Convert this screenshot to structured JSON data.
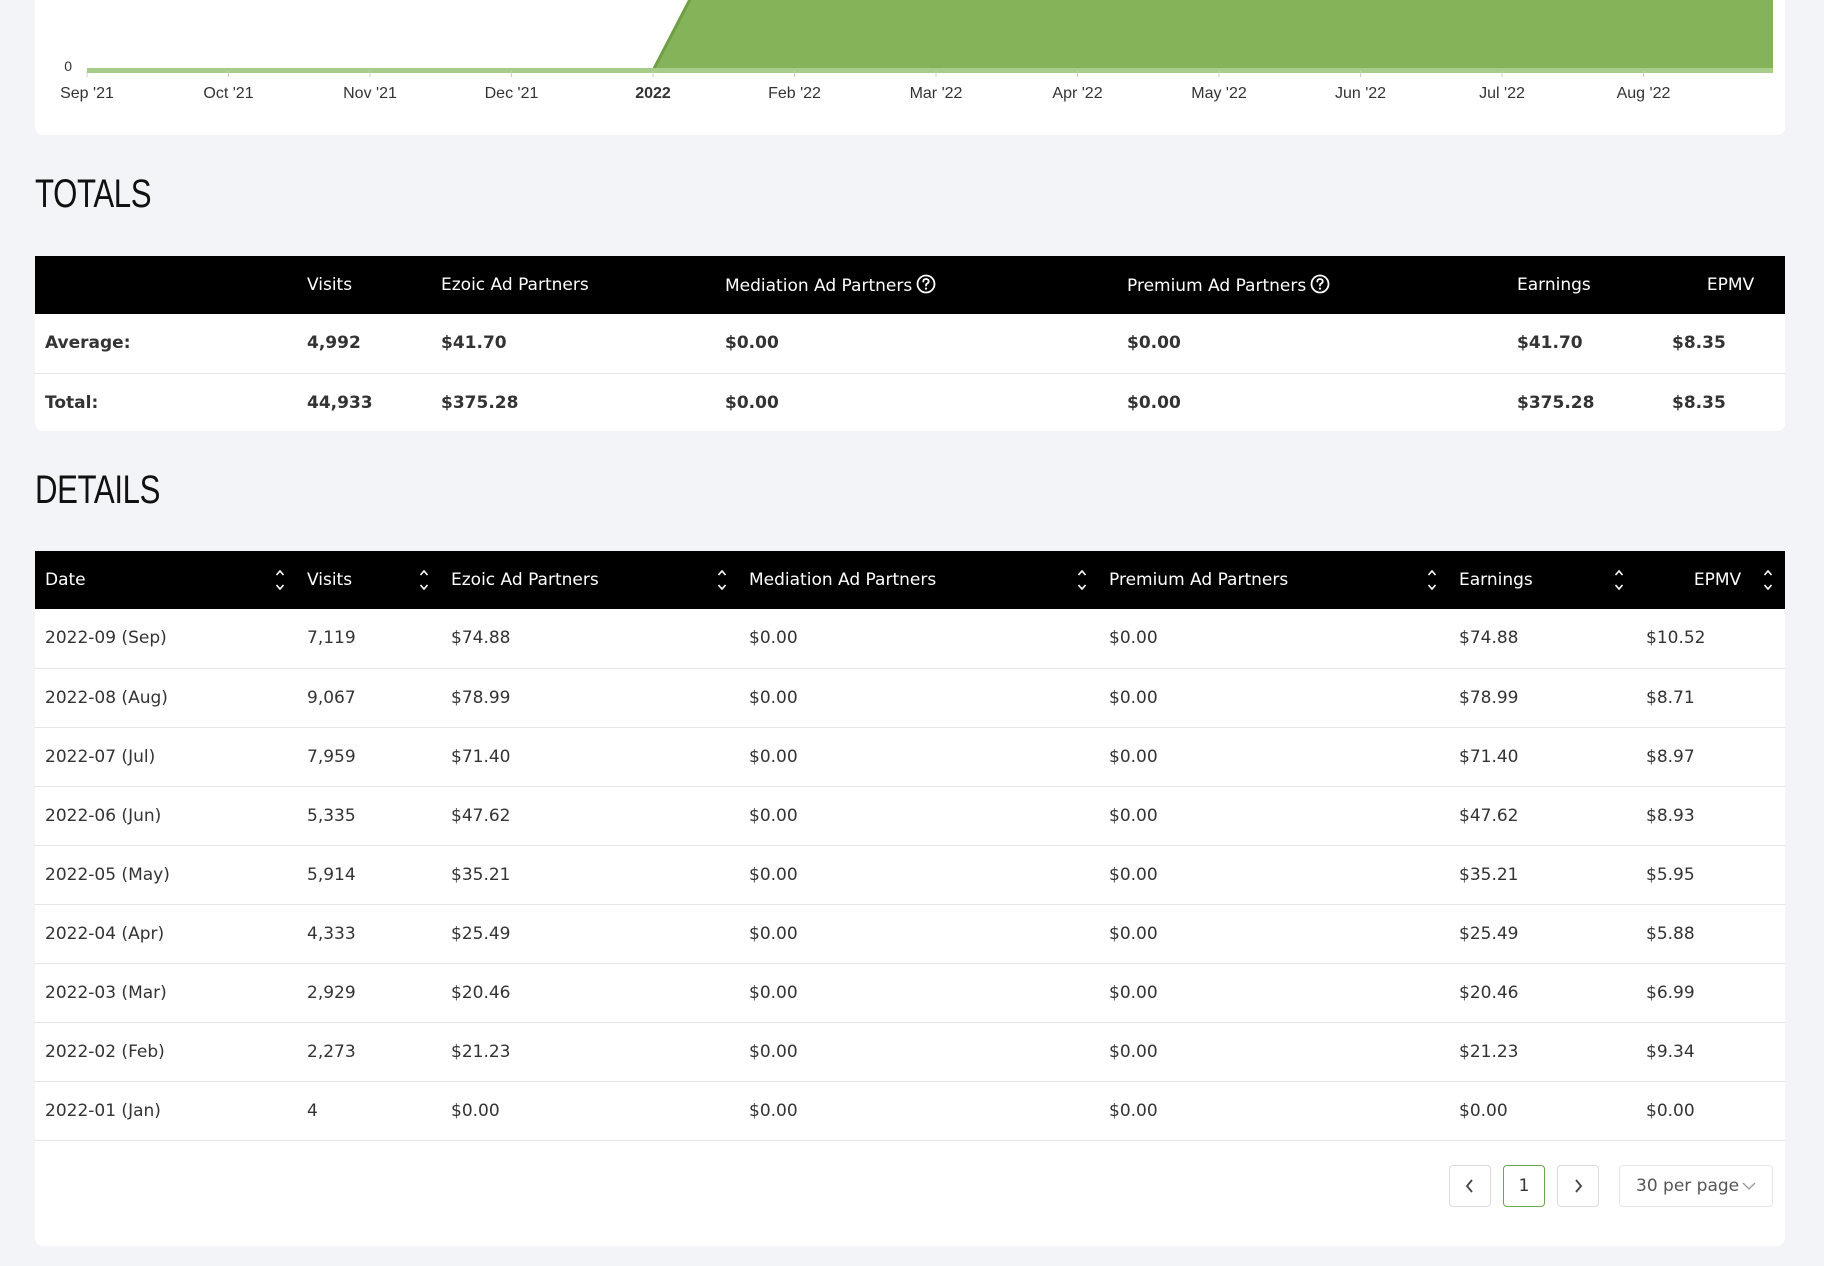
{
  "chart_data": {
    "type": "area",
    "x_tick_labels": [
      "Sep '21",
      "Oct '21",
      "Nov '21",
      "Dec '21",
      "2022",
      "Feb '22",
      "Mar '22",
      "Apr '22",
      "May '22",
      "Jun '22",
      "Jul '22",
      "Aug '22"
    ],
    "y_tick_labels": [
      "0"
    ],
    "x": [
      "2021-09",
      "2021-10",
      "2021-11",
      "2021-12",
      "2022-01",
      "2022-02",
      "2022-03",
      "2022-04",
      "2022-05",
      "2022-06",
      "2022-07",
      "2022-08",
      "2022-09"
    ],
    "values": [
      0,
      0,
      0,
      0,
      4,
      2273,
      2929,
      4333,
      5914,
      5335,
      7959,
      9067,
      7119
    ],
    "color": "#84b35a"
  },
  "totals": {
    "title": "TOTALS",
    "columns": [
      "",
      "Visits",
      "Ezoic Ad Partners",
      "Mediation Ad Partners",
      "Premium Ad Partners",
      "Earnings",
      "EPMV"
    ],
    "rows": [
      [
        "Average:",
        "4,992",
        "$41.70",
        "$0.00",
        "$0.00",
        "$41.70",
        "$8.35"
      ],
      [
        "Total:",
        "44,933",
        "$375.28",
        "$0.00",
        "$0.00",
        "$375.28",
        "$8.35"
      ]
    ]
  },
  "details": {
    "title": "DETAILS",
    "columns": [
      "Date",
      "Visits",
      "Ezoic Ad Partners",
      "Mediation Ad Partners",
      "Premium Ad Partners",
      "Earnings",
      "EPMV"
    ],
    "rows": [
      [
        "2022-09 (Sep)",
        "7,119",
        "$74.88",
        "$0.00",
        "$0.00",
        "$74.88",
        "$10.52"
      ],
      [
        "2022-08 (Aug)",
        "9,067",
        "$78.99",
        "$0.00",
        "$0.00",
        "$78.99",
        "$8.71"
      ],
      [
        "2022-07 (Jul)",
        "7,959",
        "$71.40",
        "$0.00",
        "$0.00",
        "$71.40",
        "$8.97"
      ],
      [
        "2022-06 (Jun)",
        "5,335",
        "$47.62",
        "$0.00",
        "$0.00",
        "$47.62",
        "$8.93"
      ],
      [
        "2022-05 (May)",
        "5,914",
        "$35.21",
        "$0.00",
        "$0.00",
        "$35.21",
        "$5.95"
      ],
      [
        "2022-04 (Apr)",
        "4,333",
        "$25.49",
        "$0.00",
        "$0.00",
        "$25.49",
        "$5.88"
      ],
      [
        "2022-03 (Mar)",
        "2,929",
        "$20.46",
        "$0.00",
        "$0.00",
        "$20.46",
        "$6.99"
      ],
      [
        "2022-02 (Feb)",
        "2,273",
        "$21.23",
        "$0.00",
        "$0.00",
        "$21.23",
        "$9.34"
      ],
      [
        "2022-01 (Jan)",
        "4",
        "$0.00",
        "$0.00",
        "$0.00",
        "$0.00",
        "$0.00"
      ]
    ]
  },
  "pagination": {
    "current_page": "1",
    "per_page": "30 per page"
  },
  "colors": {
    "header_bg": "#000000",
    "accent_green": "#6aa84f",
    "page_bg": "#f3f4f7"
  },
  "icons": {
    "help": "question-circle-icon",
    "sort": "sort-arrows-icon",
    "prev": "chevron-left-icon",
    "next": "chevron-right-icon",
    "dropdown": "chevron-down-icon"
  }
}
